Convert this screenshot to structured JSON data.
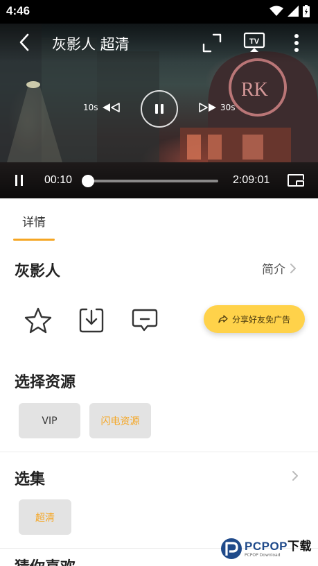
{
  "status_bar": {
    "time": "4:46"
  },
  "player": {
    "title": "灰影人 超清",
    "rewind_label": "10s",
    "forward_label": "30s",
    "current_time": "00:10",
    "total_time": "2:09:01",
    "progress": 0.001
  },
  "tabs": [
    {
      "label": "详情",
      "active": true
    }
  ],
  "detail": {
    "title": "灰影人",
    "intro_label": "简介",
    "share_label": "分享好友免广告"
  },
  "source_section": {
    "title": "选择资源",
    "options": [
      {
        "label": "VIP",
        "selected": false
      },
      {
        "label": "闪电资源",
        "selected": true
      }
    ]
  },
  "episode_section": {
    "title": "选集",
    "options": [
      {
        "label": "超清",
        "selected": true
      }
    ]
  },
  "guess_section": {
    "title": "猜你喜欢"
  },
  "watermark": {
    "brand": "PCPOP",
    "brand_cn": "下载",
    "sub": "PCPOP Download"
  },
  "colors": {
    "accent": "#f5a623",
    "share_bg": "#ffd24a",
    "chip_bg": "#e3e3e3",
    "watermark_blue": "#1f4a8a"
  },
  "icons": [
    "wifi-icon",
    "signal-icon",
    "battery-icon",
    "back-icon",
    "fullscreen-icon",
    "cast-tv-icon",
    "more-vert-icon",
    "rewind-icon",
    "pause-icon",
    "forward-icon",
    "pip-icon",
    "chevron-right-icon",
    "star-icon",
    "download-icon",
    "comment-icon",
    "share-icon"
  ]
}
